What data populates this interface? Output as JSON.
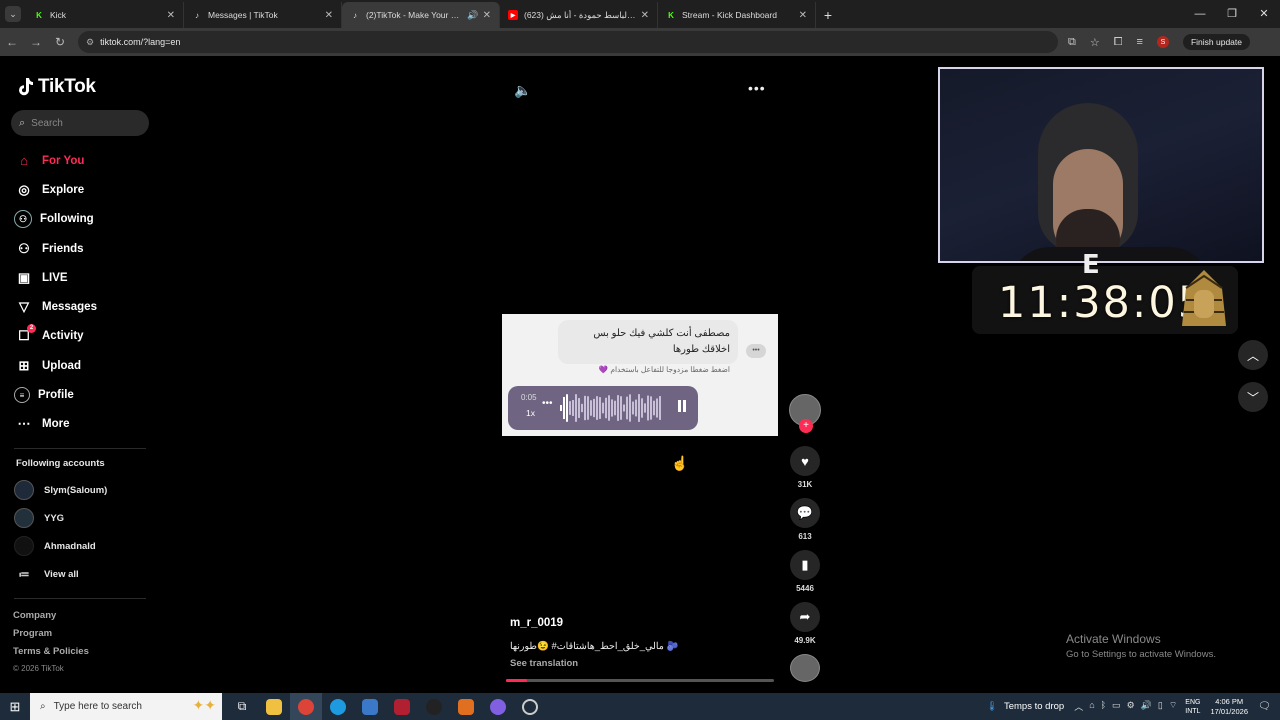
{
  "browser": {
    "tabs": [
      {
        "title": "Kick",
        "favicon": "kick-icon",
        "color": "#53fc18",
        "active": false
      },
      {
        "title": "Messages | TikTok",
        "favicon": "tiktok-icon",
        "color": "#ffffff",
        "active": false
      },
      {
        "title": "(2)TikTok - Make Your Day",
        "favicon": "tiktok-icon",
        "color": "#ffffff",
        "active": true
      },
      {
        "title": "(623) عبد الباسط حمودة - أنا مش",
        "favicon": "youtube-icon",
        "color": "#ff0000",
        "active": false
      },
      {
        "title": "Stream - Kick Dashboard",
        "favicon": "kick-icon",
        "color": "#53fc18",
        "active": false
      }
    ],
    "url": "tiktok.com/?lang=en",
    "finish_update": "Finish update",
    "profile_initial": "S"
  },
  "sidebar": {
    "brand": "TikTok",
    "search_placeholder": "Search",
    "menu": [
      {
        "label": "For You",
        "icon": "home-icon",
        "selected": true
      },
      {
        "label": "Explore",
        "icon": "compass-icon"
      },
      {
        "label": "Following",
        "icon": "following-avatar-icon"
      },
      {
        "label": "Friends",
        "icon": "friends-icon"
      },
      {
        "label": "LIVE",
        "icon": "live-tv-icon"
      },
      {
        "label": "Messages",
        "icon": "send-icon"
      },
      {
        "label": "Activity",
        "icon": "activity-icon",
        "badge": "2"
      },
      {
        "label": "Upload",
        "icon": "upload-icon"
      },
      {
        "label": "Profile",
        "icon": "profile-icon"
      },
      {
        "label": "More",
        "icon": "more-icon"
      }
    ],
    "following_title": "Following accounts",
    "following": [
      {
        "name": "Slym(Saloum)"
      },
      {
        "name": "YYG"
      },
      {
        "name": "Ahmadnald"
      }
    ],
    "view_all": "View all",
    "footer": {
      "company": "Company",
      "program": "Program",
      "terms": "Terms & Policies",
      "copyright": "© 2026 TikTok"
    }
  },
  "video": {
    "message_text": "مصطفى أنت كلشي فيك حلو بس اخلاقك طورها",
    "hint": "اضغط ضغطا مزدوجا للتفاعل باستخدام 💜",
    "voice_time": "0:05",
    "voice_speed": "1x",
    "author": "m_r_0019",
    "caption": "مالي_خلق_احط_هاشتاقات# 😉طورنها 🫐",
    "see_translation": "See translation",
    "progress": 0.08
  },
  "actions": {
    "likes": "31K",
    "comments": "613",
    "saves": "5446",
    "shares": "49.9K"
  },
  "overlay": {
    "timer": "11:38:05",
    "activate_title": "Activate Windows",
    "activate_sub": "Go to Settings to activate Windows."
  },
  "taskbar": {
    "search_placeholder": "Type here to search",
    "weather": "Temps to drop",
    "lang_top": "ENG",
    "lang_bottom": "INTL",
    "time": "4:06 PM",
    "date": "17/01/2026"
  }
}
